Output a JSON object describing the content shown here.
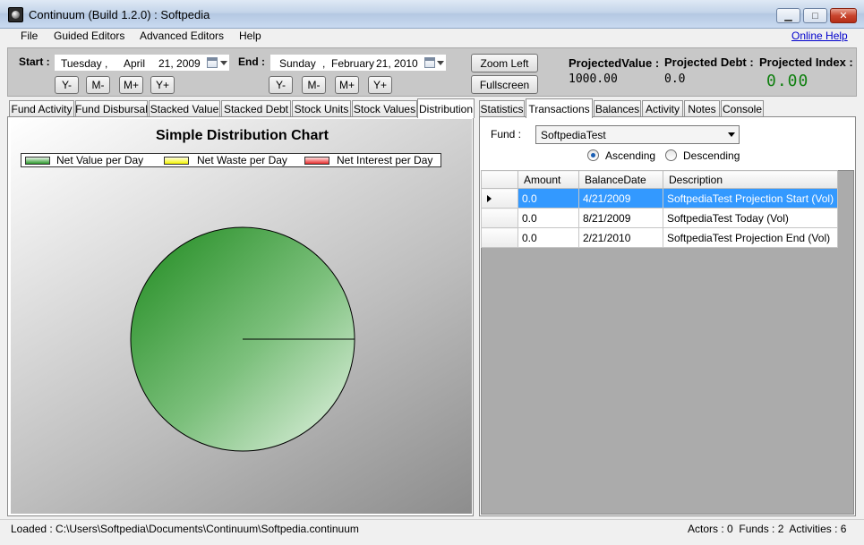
{
  "window": {
    "title": "Continuum (Build 1.2.0) : Softpedia",
    "minimize_glyph": "▁",
    "maximize_glyph": "□",
    "close_glyph": "✕"
  },
  "menu": {
    "items": [
      "File",
      "Guided Editors",
      "Advanced Editors",
      "Help"
    ],
    "online_help": "Online Help"
  },
  "toolbar": {
    "start_label": "Start :",
    "start_date": {
      "weekday": "Tuesday",
      "sep": ",",
      "month": "April",
      "day_year": "21, 2009"
    },
    "end_label": "End :",
    "end_date": {
      "weekday": "Sunday",
      "sep": ",",
      "month": "February",
      "day_year": "21, 2010"
    },
    "step_buttons": [
      "Y-",
      "M-",
      "M+",
      "Y+"
    ],
    "zoom_left": "Zoom Left",
    "fullscreen": "Fullscreen",
    "projected_value_label": "ProjectedValue :",
    "projected_value": "1000.00",
    "projected_debt_label": "Projected Debt :",
    "projected_debt": "0.0",
    "projected_index_label": "Projected Index :",
    "projected_index": "0.00"
  },
  "left_tabs": [
    "Fund Activity",
    "Fund Disbursal",
    "Stacked Value",
    "Stacked Debt",
    "Stock Units",
    "Stock Values",
    "Distribution"
  ],
  "left_active_tab": "Distribution",
  "chart": {
    "title": "Simple Distribution Chart",
    "legend": [
      {
        "label": "Net Value per Day",
        "color": "#2a9a2a"
      },
      {
        "label": "Net Waste per Day",
        "color": "#f4f400"
      },
      {
        "label": "Net Interest per Day",
        "color": "#e82a2a"
      }
    ]
  },
  "chart_data": {
    "type": "pie",
    "title": "Simple Distribution Chart",
    "categories": [
      "Net Value per Day",
      "Net Waste per Day",
      "Net Interest per Day"
    ],
    "values": [
      100,
      0,
      0
    ],
    "colors": [
      "#2a9a2a",
      "#f4f400",
      "#e82a2a"
    ],
    "legend_position": "top"
  },
  "right_tabs": [
    "Statistics",
    "Transactions",
    "Balances",
    "Activity",
    "Notes",
    "Console"
  ],
  "right_active_tab": "Transactions",
  "transactions": {
    "fund_label": "Fund :",
    "fund_value": "SoftpediaTest",
    "sort_ascending": "Ascending",
    "sort_descending": "Descending",
    "columns": [
      "Amount",
      "BalanceDate",
      "Description"
    ],
    "rows": [
      {
        "amount": "0.0",
        "date": "4/21/2009",
        "description": "SoftpediaTest Projection Start (Vol)",
        "selected": true
      },
      {
        "amount": "0.0",
        "date": "8/21/2009",
        "description": "SoftpediaTest Today (Vol)",
        "selected": false
      },
      {
        "amount": "0.0",
        "date": "2/21/2010",
        "description": "SoftpediaTest Projection End (Vol)",
        "selected": false
      }
    ]
  },
  "status": {
    "loaded": "Loaded : C:\\Users\\Softpedia\\Documents\\Continuum\\Softpedia.continuum",
    "actors": "Actors : 0",
    "funds": "Funds : 2",
    "activities": "Activities : 6"
  }
}
